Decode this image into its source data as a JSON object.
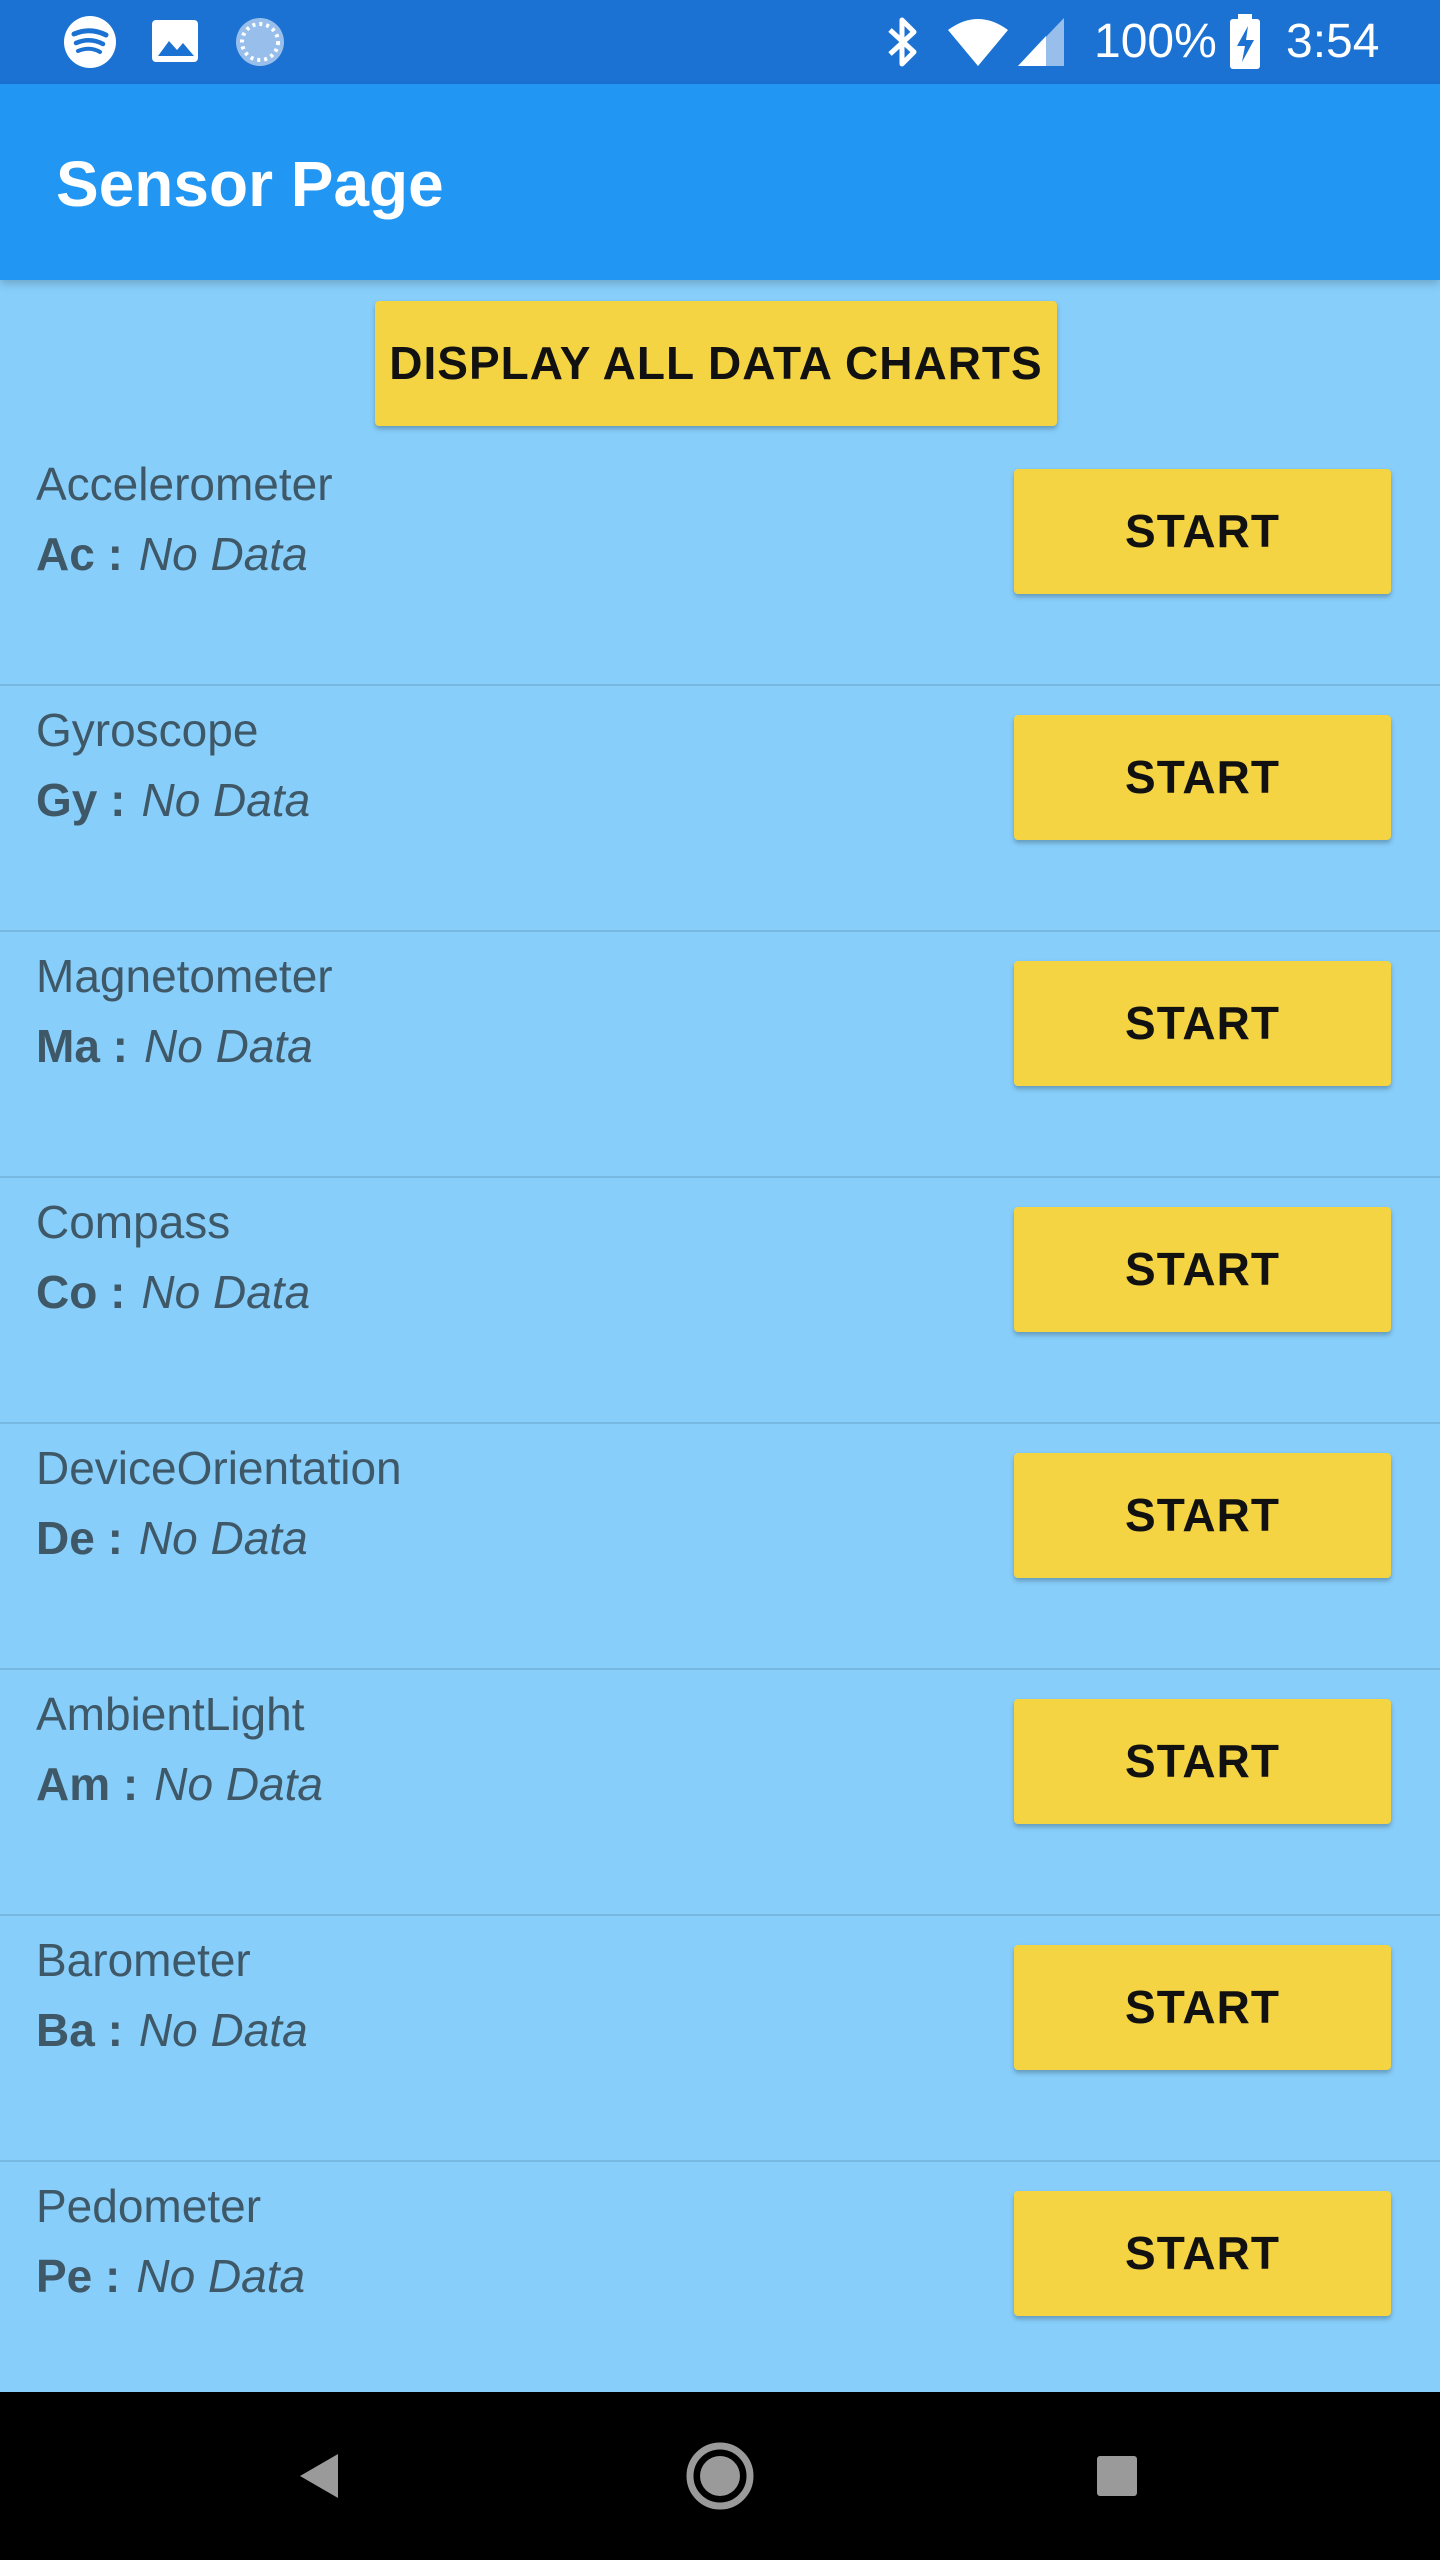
{
  "status_bar": {
    "left_icons": [
      "spotify-icon",
      "image-icon",
      "sync-icon"
    ],
    "right_icons": [
      "bluetooth-icon",
      "wifi-icon",
      "cell-signal-icon",
      "battery-charging-icon"
    ],
    "battery_percent": "100%",
    "time": "3:54"
  },
  "app_bar": {
    "title": "Sensor Page",
    "color": "#2196f3"
  },
  "display_all_button": {
    "label": "DISPLAY ALL DATA CHARTS"
  },
  "sensors": [
    {
      "name": "Accelerometer",
      "abbr": "Ac :",
      "value": "No Data",
      "button": "START"
    },
    {
      "name": "Gyroscope",
      "abbr": "Gy :",
      "value": "No Data",
      "button": "START"
    },
    {
      "name": "Magnetometer",
      "abbr": "Ma :",
      "value": "No Data",
      "button": "START"
    },
    {
      "name": "Compass",
      "abbr": "Co :",
      "value": "No Data",
      "button": "START"
    },
    {
      "name": "DeviceOrientation",
      "abbr": "De :",
      "value": "No Data",
      "button": "START"
    },
    {
      "name": "AmbientLight",
      "abbr": "Am :",
      "value": "No Data",
      "button": "START"
    },
    {
      "name": "Barometer",
      "abbr": "Ba :",
      "value": "No Data",
      "button": "START"
    },
    {
      "name": "Pedometer",
      "abbr": "Pe :",
      "value": "No Data",
      "button": "START"
    }
  ],
  "nav_bar": {
    "icons": [
      "back-icon",
      "home-icon",
      "recents-icon"
    ]
  },
  "colors": {
    "background": "#87cefa",
    "button": "#f4d442",
    "status_bar": "#1b72d2"
  }
}
